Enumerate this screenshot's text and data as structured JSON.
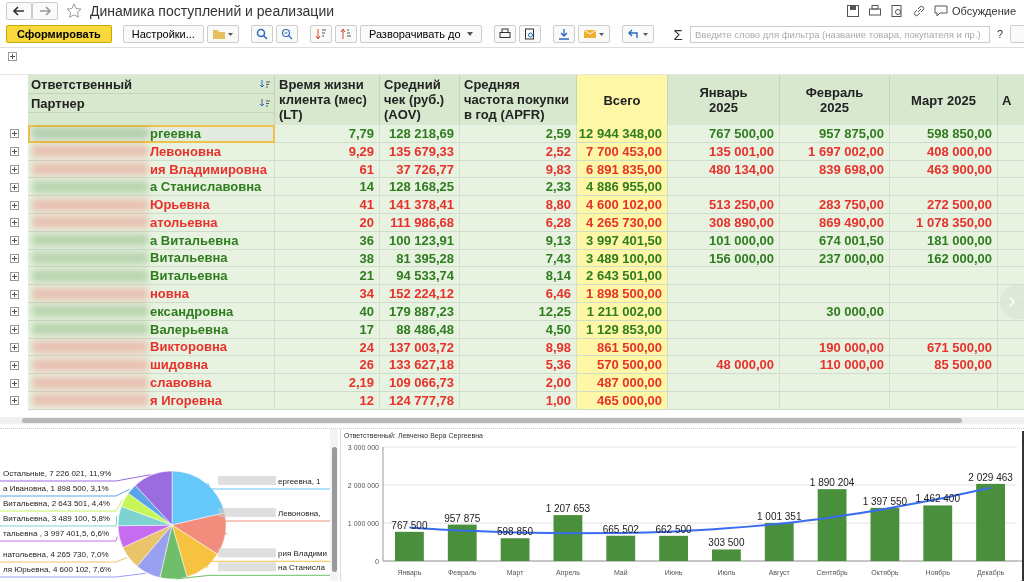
{
  "window": {
    "title": "Динамика поступлений и реализации",
    "discussion": "Обсуждение"
  },
  "toolbar": {
    "generate": "Сформировать",
    "settings": "Настройки...",
    "expand": "Разворачивать до",
    "filter_placeholder": "Введите слово для фильтра (название товара, покупателя и пр.)",
    "sigma": "Σ",
    "help": "?"
  },
  "table": {
    "columns": {
      "group1": "Ответственный",
      "group2": "Партнер",
      "lt": "Время жизни клиента (мес) (LT)",
      "aov": "Средний чек (руб.) (AOV)",
      "apfr": "Средняя частота покупки в год (APFR)",
      "total": "Всего",
      "months": [
        "Январь 2025",
        "Февраль 2025",
        "Март 2025",
        "А"
      ]
    },
    "rows": [
      {
        "name": "ргеевна",
        "lt": "7,79",
        "aov": "128 218,69",
        "apfr": "2,59",
        "total": "12 944 348,00",
        "jan": "767 500,00",
        "feb": "957 875,00",
        "mar": "598 850,00",
        "color": "#2e7d1e",
        "selected": true
      },
      {
        "name": "Левоновна",
        "lt": "9,29",
        "aov": "135 679,33",
        "apfr": "2,52",
        "total": "7 700 453,00",
        "jan": "135 001,00",
        "feb": "1 697 002,00",
        "mar": "408 000,00",
        "color": "#e8312a",
        "selected": false
      },
      {
        "name": "ия Владимировна",
        "lt": "61",
        "aov": "37 726,77",
        "apfr": "9,83",
        "total": "6 891 835,00",
        "jan": "480 134,00",
        "feb": "839 698,00",
        "mar": "463 900,00",
        "color": "#e8312a",
        "selected": false
      },
      {
        "name": "а Станиславовна",
        "lt": "14",
        "aov": "128 168,25",
        "apfr": "2,33",
        "total": "4 886 955,00",
        "color": "#2e7d1e",
        "selected": false
      },
      {
        "name": "Юрьевна",
        "lt": "41",
        "aov": "141 378,41",
        "apfr": "8,80",
        "total": "4 600 102,00",
        "jan": "513 250,00",
        "feb": "283 750,00",
        "mar": "272 500,00",
        "color": "#e8312a",
        "selected": false
      },
      {
        "name": "атольевна",
        "lt": "20",
        "aov": "111 986,68",
        "apfr": "6,28",
        "total": "4 265 730,00",
        "jan": "308 890,00",
        "feb": "869 490,00",
        "mar": "1 078 350,00",
        "color": "#e8312a",
        "selected": false
      },
      {
        "name": "а Витальевна",
        "lt": "36",
        "aov": "100 123,91",
        "apfr": "9,13",
        "total": "3 997 401,50",
        "jan": "101 000,00",
        "feb": "674 001,50",
        "mar": "181 000,00",
        "color": "#2e7d1e",
        "selected": false
      },
      {
        "name": "Витальевна",
        "lt": "38",
        "aov": "81 395,28",
        "apfr": "7,43",
        "total": "3 489 100,00",
        "jan": "156 000,00",
        "feb": "237 000,00",
        "mar": "162 000,00",
        "color": "#2e7d1e",
        "selected": false
      },
      {
        "name": "Витальевна",
        "lt": "21",
        "aov": "94 533,74",
        "apfr": "8,14",
        "total": "2 643 501,00",
        "color": "#2e7d1e",
        "selected": false
      },
      {
        "name": "новна",
        "lt": "34",
        "aov": "152 224,12",
        "apfr": "6,46",
        "total": "1 898 500,00",
        "color": "#e8312a",
        "selected": false
      },
      {
        "name": "ександровна",
        "lt": "40",
        "aov": "179 887,23",
        "apfr": "12,25",
        "total": "1 211 002,00",
        "feb": "30 000,00",
        "color": "#2e7d1e",
        "selected": false
      },
      {
        "name": "Валерьевна",
        "lt": "17",
        "aov": "88 486,48",
        "apfr": "4,50",
        "total": "1 129 853,00",
        "color": "#2e7d1e",
        "selected": false
      },
      {
        "name": "Викторовна",
        "lt": "24",
        "aov": "137 003,72",
        "apfr": "8,98",
        "total": "861 500,00",
        "feb": "190 000,00",
        "mar": "671 500,00",
        "color": "#e8312a",
        "selected": false
      },
      {
        "name": "шидовна",
        "lt": "26",
        "aov": "133 627,18",
        "apfr": "5,36",
        "total": "570 500,00",
        "jan": "48 000,00",
        "feb": "110 000,00",
        "mar": "85 500,00",
        "color": "#e8312a",
        "selected": false
      },
      {
        "name": "славовна",
        "lt": "2,19",
        "aov": "109 066,73",
        "apfr": "2,00",
        "total": "487 000,00",
        "color": "#e8312a",
        "selected": false
      },
      {
        "name": "я Игоревна",
        "lt": "12",
        "aov": "124 777,78",
        "apfr": "1,00",
        "total": "465 000,00",
        "color": "#e8312a",
        "selected": false
      }
    ]
  },
  "pie": {
    "slice_labels": [
      "Остальные, 7 226 021, 11,9%",
      "а Ивановна, 1 898 500, 3,1%",
      "Витальевна, 2 643 501, 4,4%",
      "Витальевна, 3 489 100, 5,8%",
      "тальевна , 3 997 401,5, 6,6%",
      "натольевна, 4 265 730, 7,0%",
      "ля Юрьевна, 4 600 102, 7,6%",
      "ергеевна, 1",
      " Левоновна,",
      "рия Владими",
      "на Станисла"
    ],
    "chart_data": {
      "type": "pie",
      "values": [
        21.4,
        12.7,
        11.4,
        8.1,
        7.6,
        7.0,
        6.6,
        5.8,
        4.4,
        3.1,
        11.9
      ]
    }
  },
  "bar_chart": {
    "chart_data": {
      "type": "bar",
      "title": "Ответственный: Левченко Вера Сергеевна",
      "categories": [
        "Январь",
        "Февраль",
        "Март",
        "Апрель",
        "Май",
        "Июнь",
        "Июль",
        "Август",
        "Сентябрь",
        "Октябрь",
        "Ноябрь",
        "Декабрь"
      ],
      "series": [
        {
          "type": "bar",
          "color": "#4a8f3c",
          "values": [
            767500,
            957875,
            598850,
            1207653,
            665502,
            662500,
            303500,
            1001351,
            1890204,
            1397550,
            1462400,
            2029463
          ]
        },
        {
          "type": "line",
          "color": "#3a6cf0",
          "values": [
            880000,
            800000,
            750000,
            730000,
            740000,
            780000,
            860000,
            980000,
            1150000,
            1370000,
            1630000,
            1930000
          ]
        }
      ],
      "value_labels": [
        "767 500",
        "957 875",
        "598 850",
        "1 207 653",
        "665 502",
        "662 500",
        "303 500",
        "1 001 351",
        "1 890 204",
        "1 397 550",
        "1 462 400",
        "2 029 463"
      ],
      "ylim": [
        0,
        3000000
      ],
      "yticks": [
        {
          "value": 0,
          "label": "0"
        },
        {
          "value": 1000000,
          "label": "1 000 000"
        },
        {
          "value": 2000000,
          "label": "2 000 000"
        },
        {
          "value": 3000000,
          "label": "3 000 000"
        }
      ]
    }
  }
}
